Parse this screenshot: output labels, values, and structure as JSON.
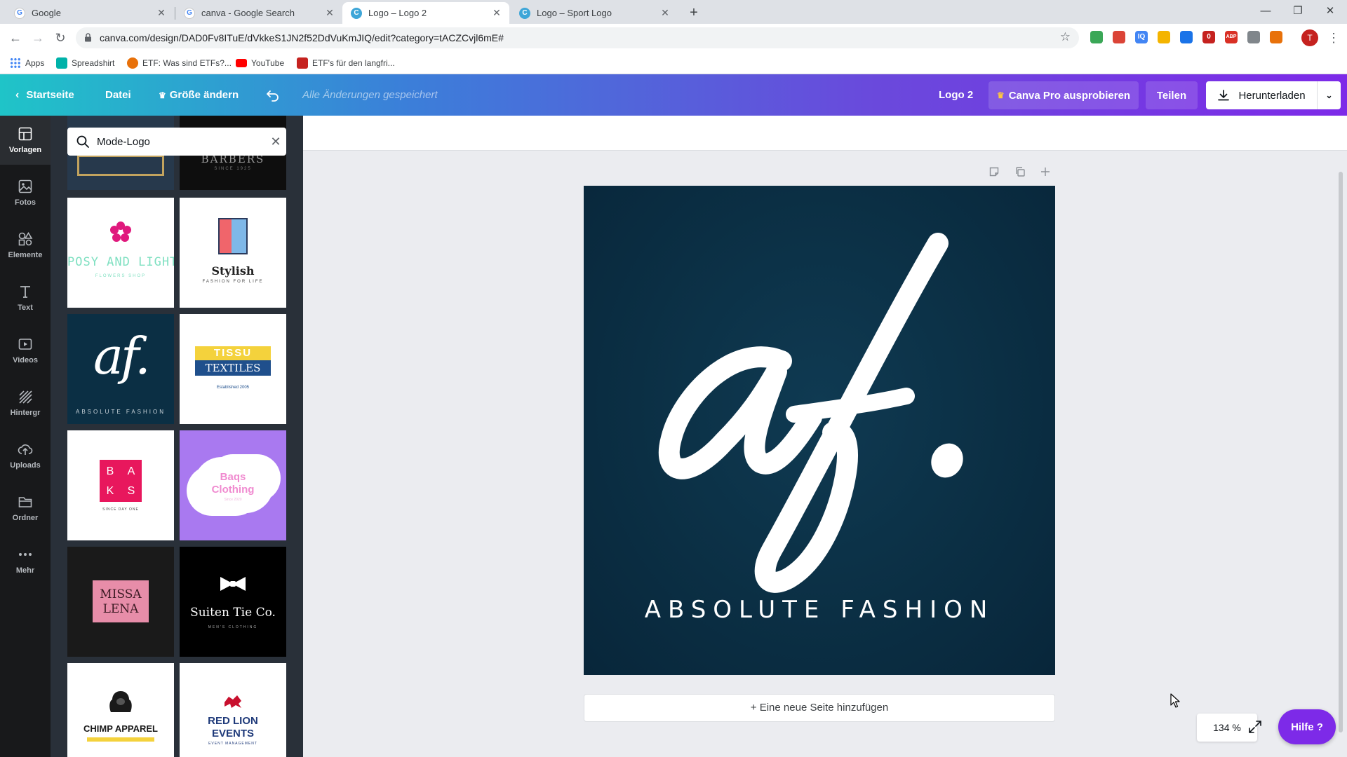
{
  "browser": {
    "tabs": [
      {
        "label": "Google",
        "favicon": "G",
        "active": false
      },
      {
        "label": "canva - Google Search",
        "favicon": "G",
        "active": false
      },
      {
        "label": "Logo – Logo 2",
        "favicon": "C",
        "active": true
      },
      {
        "label": "Logo – Sport Logo",
        "favicon": "C",
        "active": false
      }
    ],
    "url": "canva.com/design/DAD0Fv8ITuE/dVkkeS1JN2f52DdVuKmJIQ/edit?category=tACZCvjl6mE#",
    "profile_initial": "T",
    "extensions": [
      {
        "label": "",
        "color": "#3aa757"
      },
      {
        "label": "",
        "color": "#db4437"
      },
      {
        "label": "IQ",
        "color": "#4285f4"
      },
      {
        "label": "",
        "color": "#f4b400"
      },
      {
        "label": "",
        "color": "#1a73e8"
      },
      {
        "label": "0",
        "color": "#c5221f"
      },
      {
        "label": "ABP",
        "color": "#d93025"
      },
      {
        "label": "",
        "color": "#80868b"
      },
      {
        "label": "",
        "color": "#e8710a"
      }
    ],
    "bookmarks": [
      {
        "label": "Apps",
        "color": "#4285f4"
      },
      {
        "label": "Spreadshirt",
        "color": "#00b2a9"
      },
      {
        "label": "ETF: Was sind ETFs?...",
        "color": "#e8710a"
      },
      {
        "label": "YouTube",
        "color": "#ff0000"
      },
      {
        "label": "ETF's für den langfri...",
        "color": "#c5221f"
      }
    ]
  },
  "canva": {
    "home": "Startseite",
    "file": "Datei",
    "resize": "Größe ändern",
    "saved_status": "Alle Änderungen gespeichert",
    "design_name": "Logo 2",
    "pro": "Canva Pro ausprobieren",
    "share": "Teilen",
    "download": "Herunterladen"
  },
  "rail": [
    {
      "label": "Vorlagen",
      "icon": "templates-icon",
      "active": true
    },
    {
      "label": "Fotos",
      "icon": "photos-icon",
      "active": false
    },
    {
      "label": "Elemente",
      "icon": "elements-icon",
      "active": false
    },
    {
      "label": "Text",
      "icon": "text-icon",
      "active": false
    },
    {
      "label": "Videos",
      "icon": "videos-icon",
      "active": false
    },
    {
      "label": "Hintergr",
      "icon": "background-icon",
      "active": false
    },
    {
      "label": "Uploads",
      "icon": "uploads-icon",
      "active": false
    },
    {
      "label": "Ordner",
      "icon": "folder-icon",
      "active": false
    },
    {
      "label": "Mehr",
      "icon": "more-icon",
      "active": false
    }
  ],
  "panel": {
    "search_value": "Mode-Logo",
    "templates": [
      {
        "id": "barbers",
        "text": "BARBERS",
        "sub": "SINCE 1925"
      },
      {
        "id": "posy",
        "text": "POSY AND LIGHT",
        "sub": "FLOWERS SHOP"
      },
      {
        "id": "stylish",
        "text": "Stylish",
        "sub": "FASHION FOR LIFE"
      },
      {
        "id": "af",
        "text": "af.",
        "sub": "ABSOLUTE FASHION"
      },
      {
        "id": "tissu",
        "text": "TISSU",
        "text2": "TEXTILES",
        "sub": "Established 2005"
      },
      {
        "id": "baks",
        "letters": [
          "B",
          "A",
          "K",
          "S"
        ],
        "sub": "SINCE DAY ONE"
      },
      {
        "id": "baqs",
        "text": "Baqs",
        "text2": "Clothing",
        "sub": "Since 2020"
      },
      {
        "id": "missa",
        "text": "MISSA",
        "text2": "LENA"
      },
      {
        "id": "suiten",
        "text": "Suiten Tie Co.",
        "sub": "MEN'S CLOTHING"
      },
      {
        "id": "chimp",
        "text": "CHIMP APPAREL"
      },
      {
        "id": "redlion",
        "text": "RED LION",
        "text2": "EVENTS",
        "sub": "EVENT MANAGEMENT"
      }
    ]
  },
  "editor": {
    "tagline": "ABSOLUTE FASHION",
    "add_page": "+ Eine neue Seite hinzufügen",
    "zoom": "134 %",
    "help": "Hilfe ?"
  },
  "colors": {
    "accent": "#7d2ae8",
    "design_bg": "#0b2f44"
  }
}
